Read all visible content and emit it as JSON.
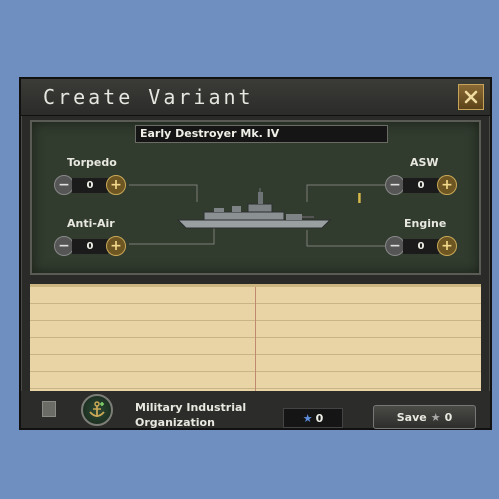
{
  "window": {
    "title": "Create Variant"
  },
  "variant_name": "Early Destroyer Mk. IV",
  "slots": [
    {
      "label": "Torpedo",
      "value": "0"
    },
    {
      "label": "Anti-Air",
      "value": "0"
    },
    {
      "label": "ASW",
      "value": "0"
    },
    {
      "label": "Engine",
      "value": "0"
    }
  ],
  "footer": {
    "mio_label": "Military Industrial Organization",
    "cost_value": "0",
    "save_label": "Save",
    "save_cost": "0"
  },
  "colors": {
    "background": "#6f8fc1",
    "accent_gold": "#c9a856",
    "cost_star": "#5e8ee0"
  },
  "icons": {
    "close": "close-icon",
    "anchor": "anchor-icon",
    "star": "star-icon",
    "ship": "destroyer-ship-icon"
  }
}
